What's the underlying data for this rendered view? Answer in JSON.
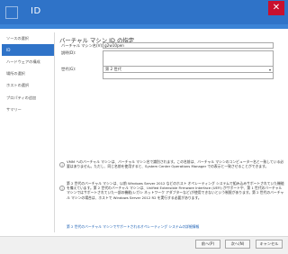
{
  "window": {
    "title": "ID",
    "close_glyph": "✕"
  },
  "sidebar": {
    "items": [
      {
        "label": "ソースの選択"
      },
      {
        "label": "ID"
      },
      {
        "label": "ハードウェアの構成"
      },
      {
        "label": "場所の選択"
      },
      {
        "label": "ホストの選択"
      },
      {
        "label": "プロパティの追加"
      },
      {
        "label": "サマリー"
      }
    ]
  },
  "main": {
    "title": "バーチャル マシン ID の指定",
    "name_label": "バーチャル マシン名(V):",
    "name_value": "g2w10pen",
    "description_label": "説明(D):",
    "generation_label": "世代(G):",
    "generation_value": "第 2 世代",
    "note1": "VMM へのバーチャル マシンは、バーチャル マシン名で識別されます。この名前は、バーチャル マシンのコンピューター名と一致している必要はありません。ただし、同じ名前を使用すると、System Center Operations Manager での表示と一致させることができます。",
    "note2": "第 2 世代のバーチャル マシンは、以前 Windows Server 2012 などのホスト オペレーティング システムで組み込みサポートされていた機能を備えています。第 2 世代のバーチャル マシンは、Unified Extensible Firmware Interface (UEFI) がサポートや、第 1 世代のバーチャル マシンではサポートされていた一部の機能(レガシ ネットワーク アダプターなど)が使用できないという制限があります。第 2 世代のバーチャル マシンの場合は、ホストで Windows Server 2012 R2 を実行する必要があります。",
    "link": "第 2 世代のバーチャル マシンでサポートされるオペレーティング システムの詳細情報"
  },
  "footer": {
    "prev_label": "前へ(P)",
    "next_label": "次へ(N)",
    "cancel_label": "キャンセル"
  },
  "colors": {
    "accent": "#2f73c8",
    "close": "#c8102e"
  }
}
